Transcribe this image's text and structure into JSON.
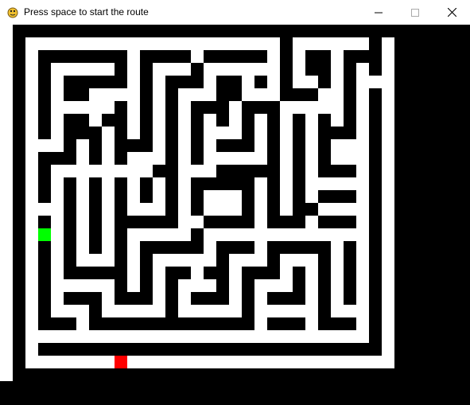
{
  "window": {
    "title": "Press space to start the route",
    "icon": "pygame-snake-icon",
    "controls": {
      "minimize": "minimize-icon",
      "maximize": "maximize-icon",
      "close": "close-icon"
    }
  },
  "game": {
    "wall_color": "#000000",
    "path_color": "#ffffff",
    "start_color": "#00ff00",
    "end_color": "#ff0000",
    "maze": {
      "rows": 28,
      "cols": 30,
      "cells": [
        "111111111111111111111111111111",
        "100000000000000000000100000010",
        "101111111011110111110101101110",
        "101000001010001000000101101010",
        "101011111010111011010100101000",
        "101011000010100011000111001010",
        "101000001010101110111000001010",
        "101011011010101010101010101010",
        "101011101010101000101010111010",
        "100010101110101011101010100010",
        "101110101000101000001010100010",
        "101000000001100011111010111010",
        "101010101010101111101010000010",
        "101010101010101000101010111010",
        "100010101000101000101011000010",
        "101010101111100111101110111010",
        "101010101000001000000000000010",
        "101010101011111011101111101010",
        "101010001010000010001000101010",
        "101011111010110110111010101010",
        "101000001010100010100010101010",
        "101011101110101110101110101010",
        "101000100000100000100000100010",
        "101110111111111111101110111010",
        "100000000000000000000000000010",
        "101111111111111111111111111110",
        "100000000000000000000000000000",
        "111111111111111111111111111111"
      ],
      "start": {
        "row": 16,
        "col": 2
      },
      "end": {
        "row": 26,
        "col": 8
      }
    }
  }
}
